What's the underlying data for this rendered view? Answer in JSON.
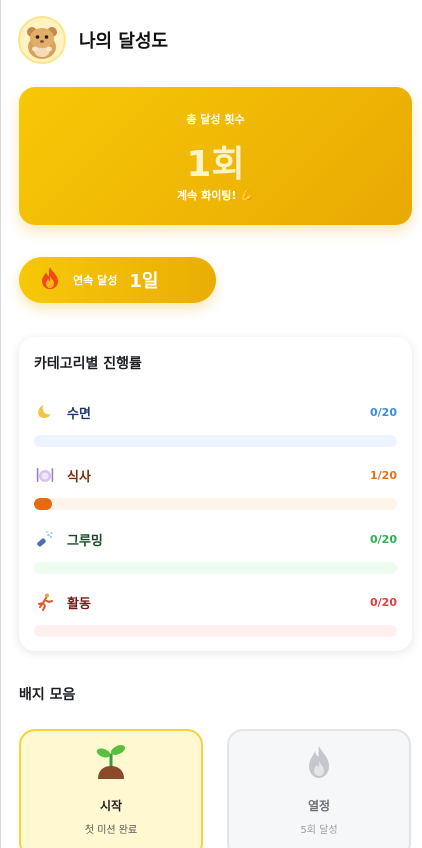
{
  "header": {
    "title": "나의 달성도",
    "avatar_icon": "hamster-icon"
  },
  "summary": {
    "total_label": "총 달성 횟수",
    "total_value": "1회",
    "cheer": "계속 화이팅! 💪"
  },
  "streak": {
    "icon": "fire-icon",
    "label": "연속 달성",
    "value": "1일"
  },
  "progress": {
    "title": "카테고리별 진행률",
    "categories": [
      {
        "name": "수면",
        "icon": "moon-icon",
        "count": "0/20",
        "done": 0,
        "total": 20,
        "color": "#3d8fd6",
        "name_color": "#1d3a6e",
        "track": "#eef4ff",
        "fill": "#3d8fd6"
      },
      {
        "name": "식사",
        "icon": "plate-cutlery-icon",
        "count": "1/20",
        "done": 1,
        "total": 20,
        "color": "#e07516",
        "name_color": "#7a2e0b",
        "track": "#fdf4ea",
        "fill": "#e56a12"
      },
      {
        "name": "그루밍",
        "icon": "grooming-icon",
        "count": "0/20",
        "done": 0,
        "total": 20,
        "color": "#2fae55",
        "name_color": "#174a27",
        "track": "#edfbf0",
        "fill": "#2fae55"
      },
      {
        "name": "활동",
        "icon": "running-icon",
        "count": "0/20",
        "done": 0,
        "total": 20,
        "color": "#e04040",
        "name_color": "#7d1616",
        "track": "#fdf0ef",
        "fill": "#e04040"
      }
    ]
  },
  "badges": {
    "title": "배지 모음",
    "items": [
      {
        "name": "시작",
        "desc": "첫 미션 완료",
        "icon": "sprout-icon",
        "earned": true
      },
      {
        "name": "열정",
        "desc": "5회 달성",
        "icon": "flame-icon",
        "earned": false
      }
    ]
  }
}
